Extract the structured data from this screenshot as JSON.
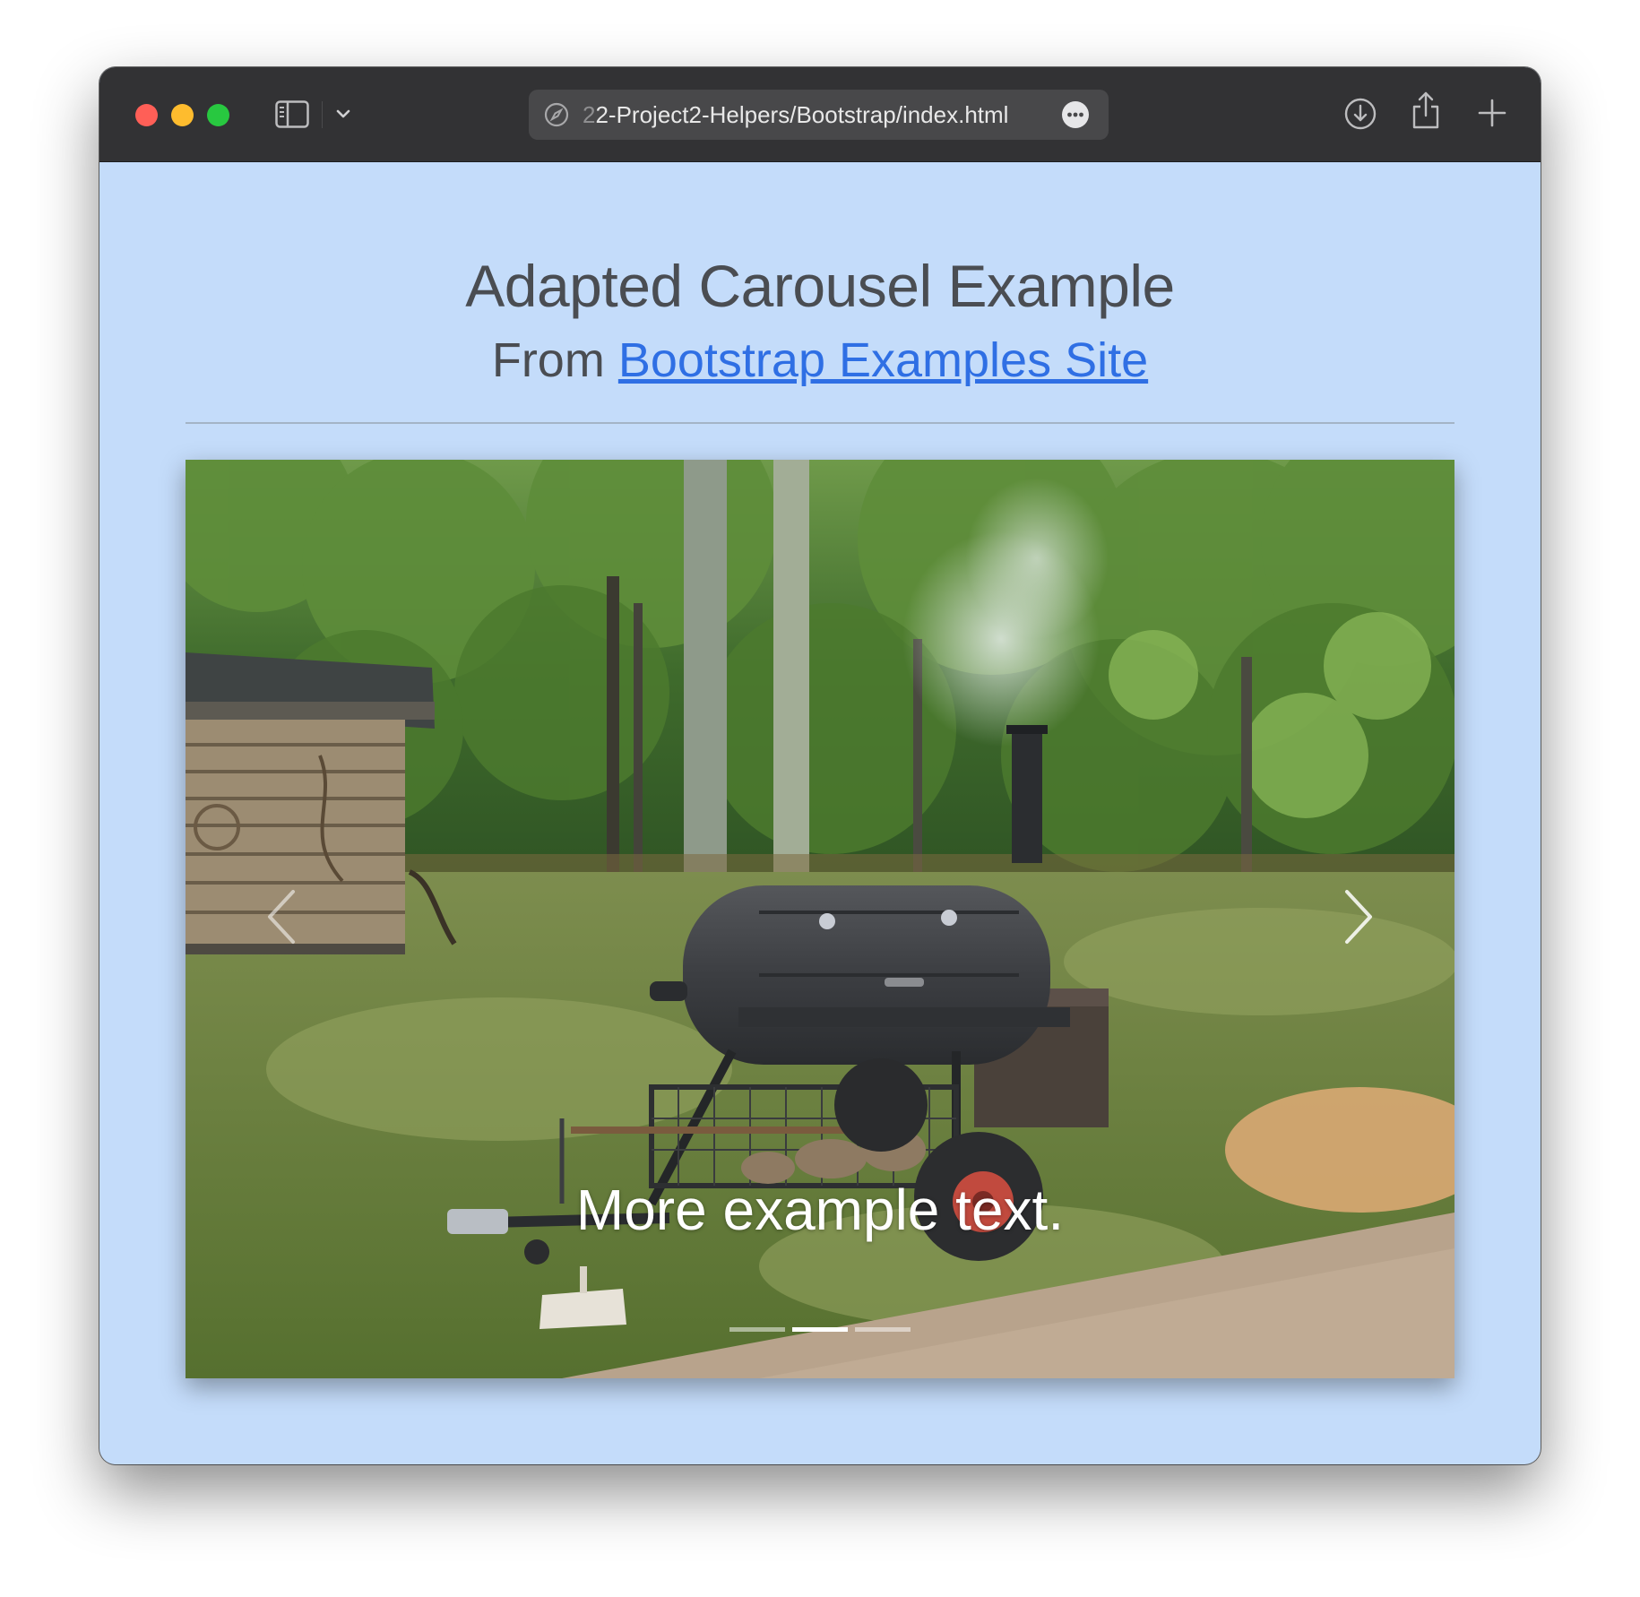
{
  "browser": {
    "url_prefix_faded": "2",
    "url_main": "2-Project2-Helpers/Bootstrap/index.html",
    "icons": [
      "sidebar-icon",
      "chevron-down-icon",
      "compass-icon",
      "more-icon",
      "download-icon",
      "share-icon",
      "plus-icon"
    ]
  },
  "page": {
    "title": "Adapted Carousel Example",
    "subtitle_prefix": "From ",
    "subtitle_link": "Bootstrap Examples Site",
    "background_color": "#c4dcfa",
    "link_color": "#2f6fe4"
  },
  "carousel": {
    "caption": "More example text.",
    "image_description_icon": "photo-smoker-grill",
    "slides_count": 3,
    "active_slide": 2,
    "controls": [
      "prev-icon",
      "next-icon"
    ]
  }
}
